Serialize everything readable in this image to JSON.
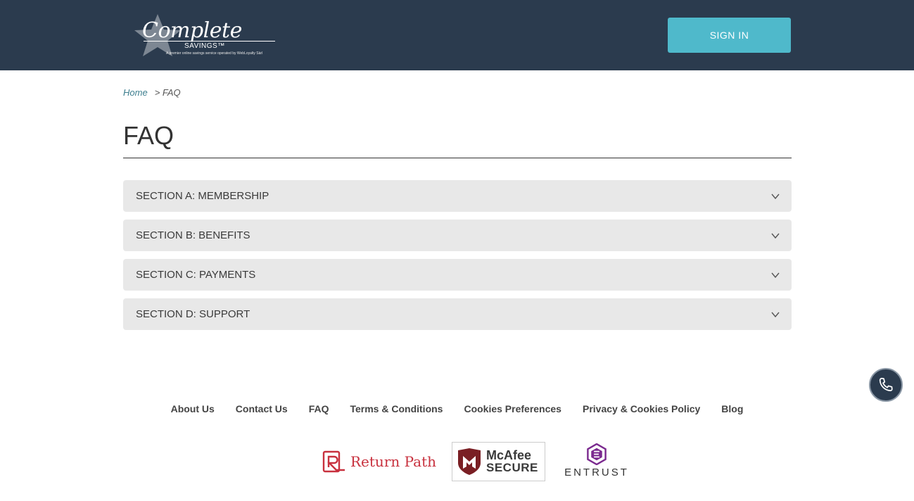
{
  "header": {
    "logo": {
      "script": "Complete",
      "savings": "SAVINGS™",
      "tagline": "A premier online savings service operated by WebLoyalty Sàrl"
    },
    "sign_in_label": "SIGN IN"
  },
  "breadcrumb": {
    "home": "Home",
    "current": "> FAQ"
  },
  "page_title": "FAQ",
  "sections": [
    {
      "label": "SECTION A: MEMBERSHIP"
    },
    {
      "label": "SECTION B: BENEFITS"
    },
    {
      "label": "SECTION C: PAYMENTS"
    },
    {
      "label": "SECTION D: SUPPORT"
    }
  ],
  "footer": {
    "links": [
      {
        "label": "About Us"
      },
      {
        "label": "Contact Us"
      },
      {
        "label": "FAQ"
      },
      {
        "label": "Terms & Conditions"
      },
      {
        "label": "Cookies Preferences"
      },
      {
        "label": "Privacy & Cookies Policy"
      },
      {
        "label": "Blog"
      }
    ],
    "badges": {
      "return_path": "Return Path",
      "mcafee_top": "McAfee",
      "mcafee_bottom": "SECURE",
      "entrust": "ENTRUST"
    }
  },
  "icons": {
    "accordion": "chevron-down-icon",
    "phone": "phone-icon",
    "logo": "star-icon"
  },
  "colors": {
    "header_bg": "#2b3b4e",
    "accent": "#4fb9cb",
    "accordion_bg": "#e8e8e8",
    "link": "#3e7f8f"
  }
}
